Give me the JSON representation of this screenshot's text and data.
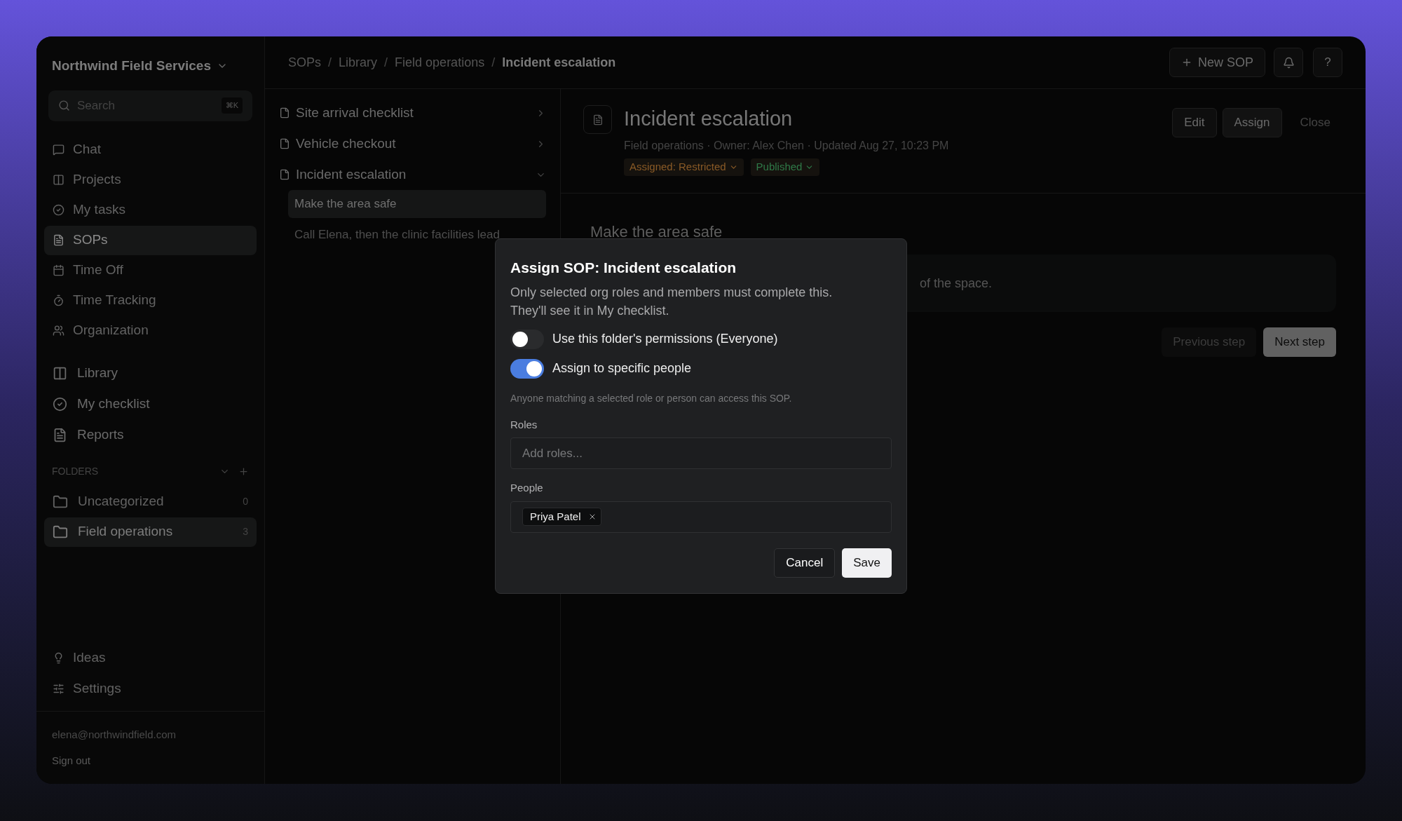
{
  "workspace": {
    "name": "Northwind Field Services"
  },
  "search": {
    "placeholder": "Search",
    "shortcut": "⌘K"
  },
  "nav": [
    {
      "label": "Chat",
      "selected": false
    },
    {
      "label": "Projects",
      "selected": false
    },
    {
      "label": "My tasks",
      "selected": false
    },
    {
      "label": "SOPs",
      "selected": true
    },
    {
      "label": "Time Off",
      "selected": false
    },
    {
      "label": "Time Tracking",
      "selected": false
    },
    {
      "label": "Organization",
      "selected": false
    }
  ],
  "library_nav": [
    {
      "label": "Library",
      "selected": false
    },
    {
      "label": "My checklist",
      "selected": false
    },
    {
      "label": "Reports",
      "selected": false
    }
  ],
  "folders": {
    "title": "FOLDERS",
    "items": [
      {
        "label": "Uncategorized",
        "count": "0",
        "selected": false
      },
      {
        "label": "Field operations",
        "count": "3",
        "selected": true
      }
    ]
  },
  "footer_nav": [
    {
      "label": "Ideas"
    },
    {
      "label": "Settings"
    }
  ],
  "account": {
    "email": "elena@northwindfield.com",
    "sign_out": "Sign out"
  },
  "breadcrumbs": [
    "SOPs",
    "Library",
    "Field operations",
    "Incident escalation"
  ],
  "breadcrumb_separators": [
    "/",
    "/",
    "/"
  ],
  "header_actions": {
    "new_sop": "New SOP",
    "help": "?"
  },
  "sop_list": [
    {
      "label": "Site arrival checklist",
      "expanded": false
    },
    {
      "label": "Vehicle checkout",
      "expanded": false
    },
    {
      "label": "Incident escalation",
      "expanded": true,
      "children": [
        {
          "label": "Make the area safe",
          "selected": true
        },
        {
          "label": "Call Elena, then the clinic facilities lead",
          "selected": false
        }
      ]
    }
  ],
  "detail": {
    "title": "Incident escalation",
    "meta": "Field operations · Owner: Alex Chen · Updated Aug 27, 10:23 PM",
    "badges": [
      {
        "label": "Assigned: Restricted",
        "color": "#8a5a26"
      },
      {
        "label": "Published",
        "color": "#2f7a48"
      }
    ],
    "actions": [
      "Edit",
      "Assign",
      "Close"
    ],
    "step_title": "Make the area safe",
    "step_text": "of the space.",
    "prev": {
      "label": "Previous step",
      "disabled": true
    },
    "next": {
      "label": "Next step",
      "disabled": false
    }
  },
  "modal": {
    "title": "Assign SOP: Incident escalation",
    "description": "Only selected org roles and members must complete this. They'll see it in My checklist.",
    "toggles": [
      {
        "label": "Use this folder's permissions (Everyone)",
        "on": false
      },
      {
        "label": "Assign to specific people",
        "on": true
      }
    ],
    "hint": "Anyone matching a selected role or person can access this SOP.",
    "roles": {
      "label": "Roles",
      "placeholder": "Add roles..."
    },
    "people": {
      "label": "People",
      "chips": [
        "Priya Patel"
      ]
    },
    "buttons": {
      "cancel": "Cancel",
      "save": "Save"
    }
  }
}
